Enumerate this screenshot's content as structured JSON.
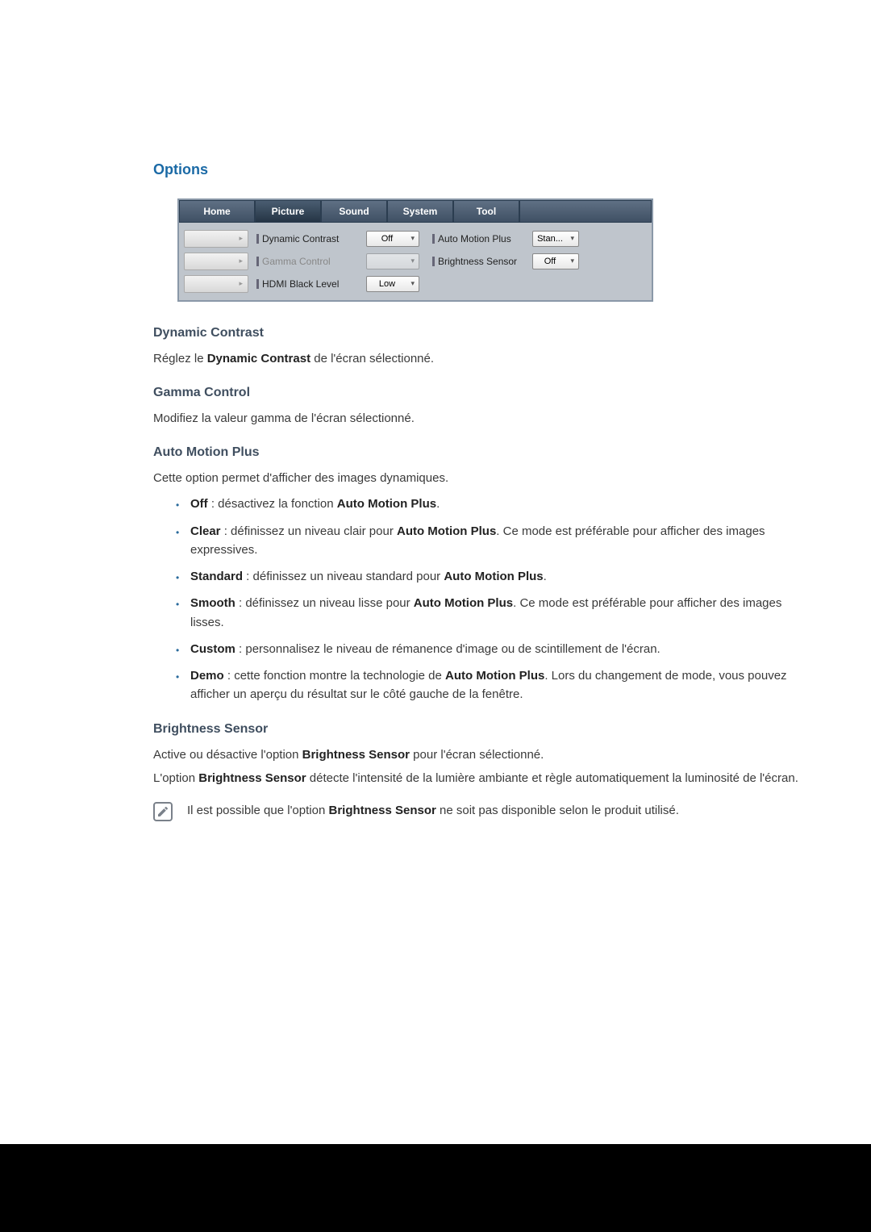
{
  "section_title": "Options",
  "ui": {
    "tabs": {
      "home": "Home",
      "picture": "Picture",
      "sound": "Sound",
      "system": "System",
      "tool": "Tool"
    },
    "row1": {
      "label1": "Dynamic Contrast",
      "sel1": "Off",
      "label2": "Auto Motion Plus",
      "sel2": "Stan..."
    },
    "row2": {
      "label1": "Gamma Control",
      "sel1": "",
      "label2": "Brightness Sensor",
      "sel2": "Off"
    },
    "row3": {
      "label1": "HDMI Black Level",
      "sel1": "Low"
    }
  },
  "dc": {
    "heading": "Dynamic Contrast",
    "pre": "Réglez le ",
    "bold": "Dynamic Contrast",
    "post": " de l'écran sélectionné."
  },
  "gc": {
    "heading": "Gamma Control",
    "text": "Modifiez la valeur gamma de l'écran sélectionné."
  },
  "amp": {
    "heading": "Auto Motion Plus",
    "intro": "Cette option permet d'afficher des images dynamiques.",
    "off_b": "Off",
    "off_t": " : désactivez la fonction ",
    "off_b2": "Auto Motion Plus",
    "off_t2": ".",
    "clear_b": "Clear",
    "clear_t": " : définissez un niveau clair pour ",
    "clear_b2": "Auto Motion Plus",
    "clear_t2": ". Ce mode est préférable pour afficher des images expressives.",
    "std_b": "Standard",
    "std_t": " : définissez un niveau standard pour ",
    "std_b2": "Auto Motion Plus",
    "std_t2": ".",
    "smooth_b": "Smooth",
    "smooth_t": " : définissez un niveau lisse pour ",
    "smooth_b2": "Auto Motion Plus",
    "smooth_t2": ". Ce mode est préférable pour afficher des images lisses.",
    "custom_b": "Custom",
    "custom_t": " : personnalisez le niveau de rémanence d'image ou de scintillement de l'écran.",
    "demo_b": "Demo",
    "demo_t": " : cette fonction montre la technologie de ",
    "demo_b2": "Auto Motion Plus",
    "demo_t2": ". Lors du changement de mode, vous pouvez afficher un aperçu du résultat sur le côté gauche de la fenêtre."
  },
  "bs": {
    "heading": "Brightness Sensor",
    "p1_pre": "Active ou désactive l'option ",
    "p1_b": "Brightness Sensor",
    "p1_post": " pour l'écran sélectionné.",
    "p2_pre": "L'option ",
    "p2_b": "Brightness Sensor",
    "p2_post": " détecte l'intensité de la lumière ambiante et règle automatiquement la luminosité de l'écran.",
    "note_pre": "Il est possible que l'option ",
    "note_b": "Brightness Sensor",
    "note_post": " ne soit pas disponible selon le produit utilisé."
  }
}
